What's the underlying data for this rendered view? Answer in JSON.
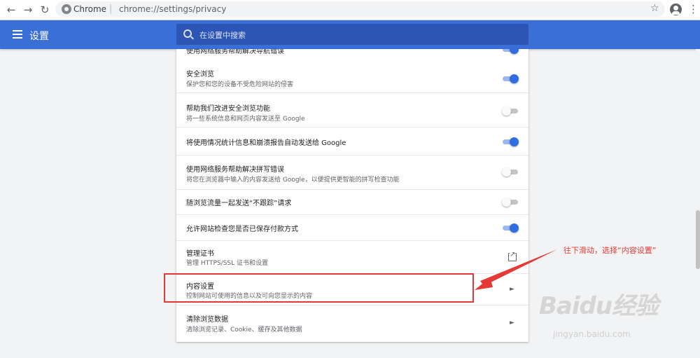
{
  "browser": {
    "back_glyph": "←",
    "forward_glyph": "→",
    "reload_glyph": "↻",
    "app_name": "Chrome",
    "url": "chrome://settings/privacy",
    "star_glyph": "☆",
    "menu_glyph": "⋮"
  },
  "header": {
    "title": "设置",
    "search_placeholder": "在设置中搜索",
    "color": "#3b6fd8"
  },
  "rows": [
    {
      "title": "使用网络服务帮助解决导航错误",
      "toggle": "on"
    },
    {
      "title": "安全浏览",
      "subtitle": "保护您和您的设备不受危险网站的侵害",
      "toggle": "on"
    },
    {
      "title": "帮助我们改进安全浏览功能",
      "subtitle": "将一些系统信息和网页内容发送至 Google",
      "toggle": "off"
    },
    {
      "title": "将使用情况统计信息和崩溃报告自动发送给 Google",
      "toggle": "on"
    },
    {
      "title": "使用网络服务帮助解决拼写错误",
      "subtitle": "将您在浏览器中输入的内容发送给 Google，以便提供更智能的拼写检查功能",
      "toggle": "off"
    },
    {
      "title": "随浏览流量一起发送“不跟踪”请求",
      "toggle": "off"
    },
    {
      "title": "允许网站检查您是否已保存付款方式",
      "toggle": "on"
    },
    {
      "title": "管理证书",
      "subtitle": "管理 HTTPS/SSL 证书和设置",
      "icon": "open-in-new-icon"
    },
    {
      "title": "内容设置",
      "subtitle": "控制网站可使用的信息以及可向您显示的内容",
      "icon": "chevron-right-icon"
    },
    {
      "title": "清除浏览数据",
      "subtitle": "清除浏览记录、Cookie、缓存及其他数据",
      "icon": "chevron-right-icon"
    }
  ],
  "chevron_glyph": "►",
  "annotation": {
    "text": "往下滑动，选择“内容设置”",
    "color": "#e53935"
  },
  "watermark": {
    "logo": "Baidu经验",
    "url": "jingyan.baidu.com"
  }
}
